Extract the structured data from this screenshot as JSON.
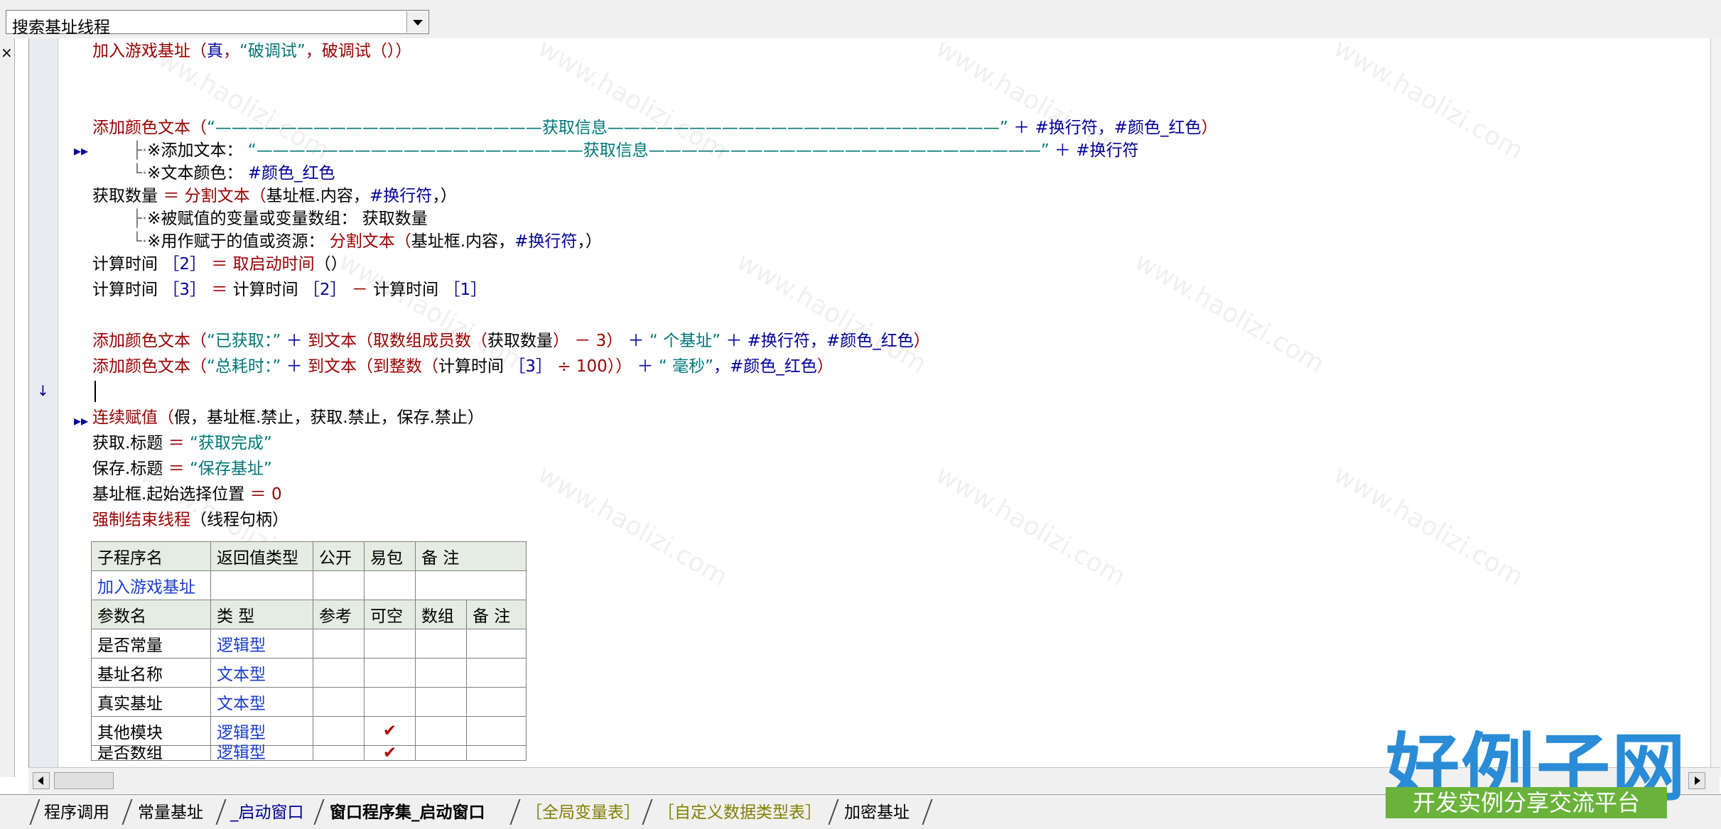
{
  "toolbar": {
    "combo_value": "搜索基址线程"
  },
  "left_strip": {
    "close_glyph": "×"
  },
  "editor": {
    "line1": {
      "func": "加入游戏基址",
      "a": "（",
      "b": "真",
      "c": "，",
      "d": "“破调试”",
      "e": "，",
      "f": "破调试",
      "g": "（））"
    },
    "line2": {
      "func": "添加颜色文本",
      "a": "（",
      "q1": "“",
      "rule1": "————————————————————",
      "mid": "获取信息",
      "rule2": "————————————————————————",
      "q2": "”",
      "plus": "＋",
      "c1": "#换行符",
      "sep": "，",
      "c2": "#颜色_红色",
      "end": "）"
    },
    "line3": {
      "tree": "├·",
      "label": "※添加文本：",
      "q1": "“",
      "rule1": "————————————————————",
      "mid": "获取信息",
      "rule2": "————————————————————————",
      "q2": "”",
      "plus": "＋",
      "c1": "#换行符"
    },
    "line4": {
      "tree": "└·",
      "label": "※文本颜色：",
      "c": "#颜色_红色"
    },
    "line5": {
      "var": "获取数量",
      "eq": "＝",
      "func": "分割文本",
      "a": "（",
      "b": "基址框.内容",
      "c": "，",
      "d": "#换行符",
      "e": "，）"
    },
    "line6": {
      "tree": "├·",
      "label": "※被赋值的变量或变量数组：",
      "v": "获取数量"
    },
    "line7": {
      "tree": "└·",
      "label": "※用作赋于的值或资源：",
      "func": "分割文本",
      "a": "（",
      "b": "基址框.内容",
      "c": "，",
      "d": "#换行符",
      "e": "，）"
    },
    "line8": {
      "var": "计算时间",
      "idx": "［2］",
      "eq": "＝",
      "func": "取启动时间",
      "rest": "（）"
    },
    "line9": {
      "var": "计算时间",
      "idx": "［3］",
      "eq": "＝",
      "v1": "计算时间",
      "idx2": "［2］",
      "minus": "－",
      "v2": "计算时间",
      "idx3": "［1］"
    },
    "line10": {
      "func": "添加颜色文本",
      "a": "（",
      "s1": "“已获取：”",
      "p1": "＋",
      "f2": "到文本",
      "b": "（",
      "f3": "取数组成员数",
      "c": "（",
      "v": "获取数量",
      "d": "）",
      "minus": "－",
      "n": "3",
      "e": "）",
      "p2": "＋",
      "s2": "“ 个基址”",
      "p3": "＋",
      "c1": "#换行符",
      "sep": "，",
      "c2": "#颜色_红色",
      "end": "）"
    },
    "line11": {
      "func": "添加颜色文本",
      "a": "（",
      "s1": "“总耗时：”",
      "p1": "＋",
      "f2": "到文本",
      "b": "（",
      "f3": "到整数",
      "c": "（",
      "v": "计算时间",
      "idx": "［3］",
      "div": "÷",
      "n": "100",
      "d": "））",
      "p2": "＋",
      "s2": "“ 毫秒”",
      "sep0": "，",
      "c2": "#颜色_红色",
      "end": "）"
    },
    "line12": {
      "func": "连续赋值",
      "a": "（",
      "b": "假",
      "c": "，",
      "d": "基址框.禁止",
      "e": "，",
      "f": "获取.禁止",
      "g": "，",
      "h": "保存.禁止",
      "end": "）"
    },
    "line13": {
      "v": "获取.标题",
      "eq": "＝",
      "s": "“获取完成”"
    },
    "line14": {
      "v": "保存.标题",
      "eq": "＝",
      "s": "“保存基址”"
    },
    "line15": {
      "v": "基址框.起始选择位置",
      "eq": "＝",
      "n": "0"
    },
    "line16": {
      "func": "强制结束线程",
      "rest": "（线程句柄）"
    },
    "markers": {
      "m1": "▸▸",
      "m2": "↓",
      "m3": "▸▸"
    }
  },
  "decl_table": {
    "sub_headers": [
      "子程序名",
      "返回值类型",
      "公开",
      "易包",
      "备 注"
    ],
    "sub_name": "加入游戏基址",
    "param_headers": [
      "参数名",
      "类 型",
      "参考",
      "可空",
      "数组",
      "备 注"
    ],
    "params": [
      {
        "name": "是否常量",
        "type": "逻辑型",
        "nullable": ""
      },
      {
        "name": "基址名称",
        "type": "文本型",
        "nullable": ""
      },
      {
        "name": "真实基址",
        "type": "文本型",
        "nullable": ""
      },
      {
        "name": "其他模块",
        "type": "逻辑型",
        "nullable": "✔"
      },
      {
        "name": "是否数组",
        "type": "逻辑型",
        "nullable": "✔"
      }
    ]
  },
  "tabs": [
    "程序调用",
    "常量基址",
    "_启动窗口",
    "窗口程序集_启动窗口",
    "［全局变量表］",
    "［自定义数据类型表］",
    "加密基址"
  ],
  "watermark_text": "www.haolizi.com",
  "logo": {
    "main": "好例子网",
    "sub": "开发实例分享交流平台"
  },
  "colors": {
    "keyword": "#990000",
    "constant": "#000099",
    "string": "#007777",
    "type": "#1a3dcc",
    "logo_blue": "#2a8bd6",
    "logo_green": "#69b33a"
  }
}
